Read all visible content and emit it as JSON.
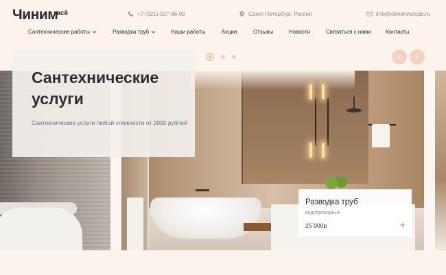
{
  "brand": {
    "logo_text": "Чиним",
    "logo_sup": "всё"
  },
  "contacts": {
    "phone": "+7-(921)-927-86-09",
    "city": "Санкт-Петербург, Россия",
    "email": "info@chinimvsespb.ru"
  },
  "nav": {
    "items": [
      {
        "label": "Сантехнические работы",
        "has_dropdown": true
      },
      {
        "label": "Разводка труб",
        "has_dropdown": true
      },
      {
        "label": "Наши работы",
        "has_dropdown": false
      },
      {
        "label": "Акции",
        "has_dropdown": false
      },
      {
        "label": "Отзывы",
        "has_dropdown": false
      },
      {
        "label": "Новости",
        "has_dropdown": false
      },
      {
        "label": "Связаться с нами",
        "has_dropdown": false
      },
      {
        "label": "Контакты",
        "has_dropdown": false
      }
    ]
  },
  "slider": {
    "total_dots": 3,
    "active_dot": 1
  },
  "hero": {
    "title": "Сантехнические услуги",
    "subtitle": "Сантехнические услуги любой сложности от 2000 рублей"
  },
  "product_card": {
    "title": "Разводка труб",
    "subtitle": "водопроводных",
    "price": "25`000р"
  },
  "colors": {
    "accent": "#f4b189",
    "arrow_bg": "#f4d2bd",
    "peach_bg": "#fbf3ec"
  },
  "icons": {
    "phone": "phone-icon",
    "location": "location-pin-icon",
    "email": "mail-icon"
  }
}
